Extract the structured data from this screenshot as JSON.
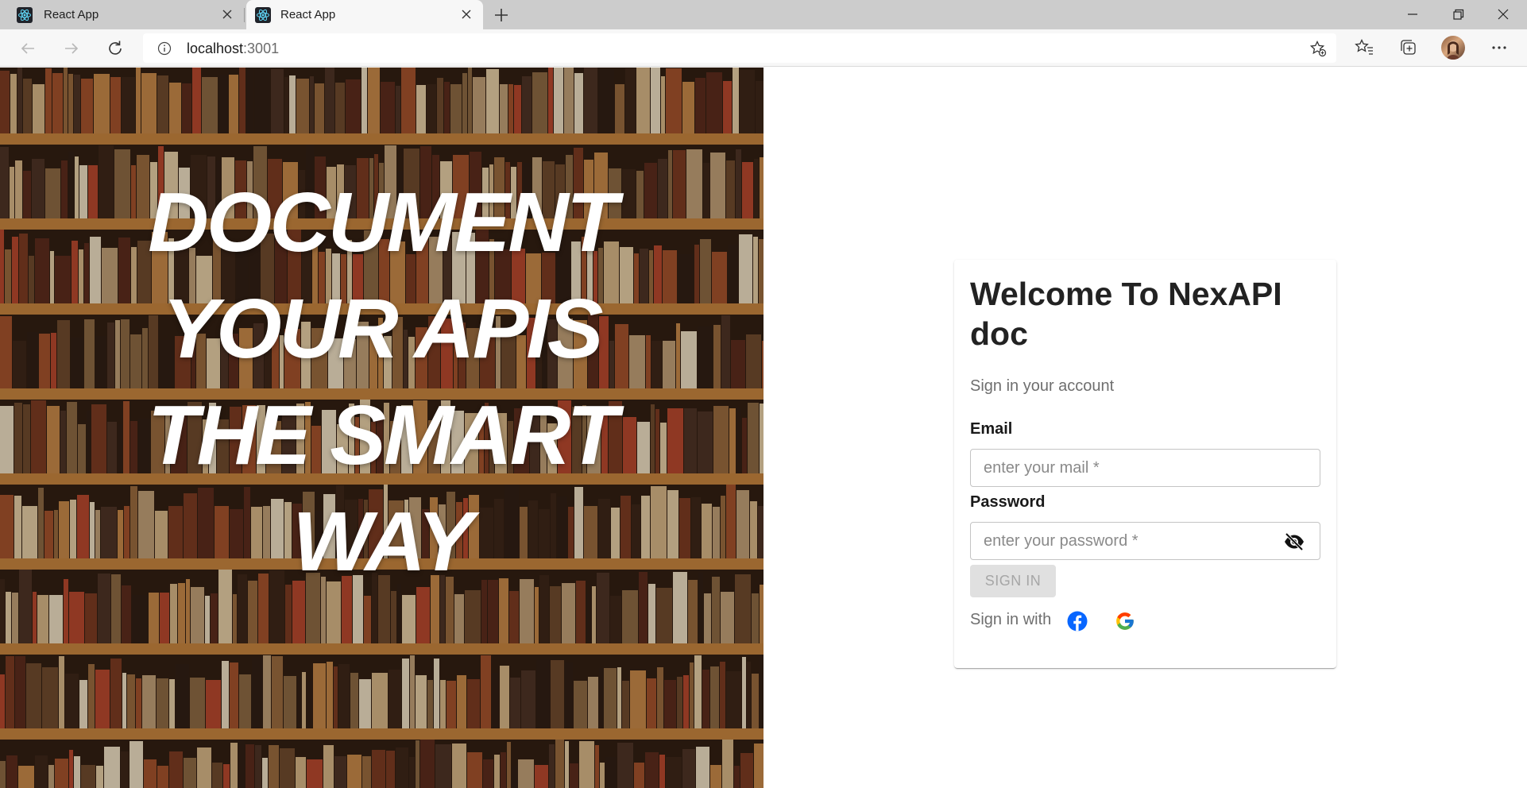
{
  "browser": {
    "tabs": [
      {
        "title": "React App",
        "active": false
      },
      {
        "title": "React App",
        "active": true
      }
    ],
    "url_host": "localhost",
    "url_port": ":3001",
    "icons": {
      "favicon": "react-logo-icon",
      "back": "back-arrow-icon",
      "forward": "forward-arrow-icon",
      "reload": "reload-icon",
      "info": "info-icon",
      "favorite": "add-favorite-icon",
      "favorites": "favorites-icon",
      "collections": "collections-icon",
      "menu": "more-menu-icon"
    }
  },
  "hero": {
    "lines": [
      "DOCUMENT",
      "YOUR APIS",
      "THE SMART",
      "WAY"
    ]
  },
  "login": {
    "title": "Welcome To NexAPI doc",
    "subtitle": "Sign in your account",
    "email_label": "Email",
    "email_placeholder": "enter your mail *",
    "email_value": "",
    "password_label": "Password",
    "password_placeholder": "enter your password *",
    "password_value": "",
    "signin_button": "SIGN IN",
    "signin_with": "Sign in with",
    "social": [
      "facebook",
      "google"
    ]
  },
  "colors": {
    "facebook": "#0866ff",
    "button_disabled_bg": "#e0e0e0",
    "button_disabled_text": "#a6a6a6",
    "title": "#222222",
    "muted": "#6f6f6f"
  }
}
